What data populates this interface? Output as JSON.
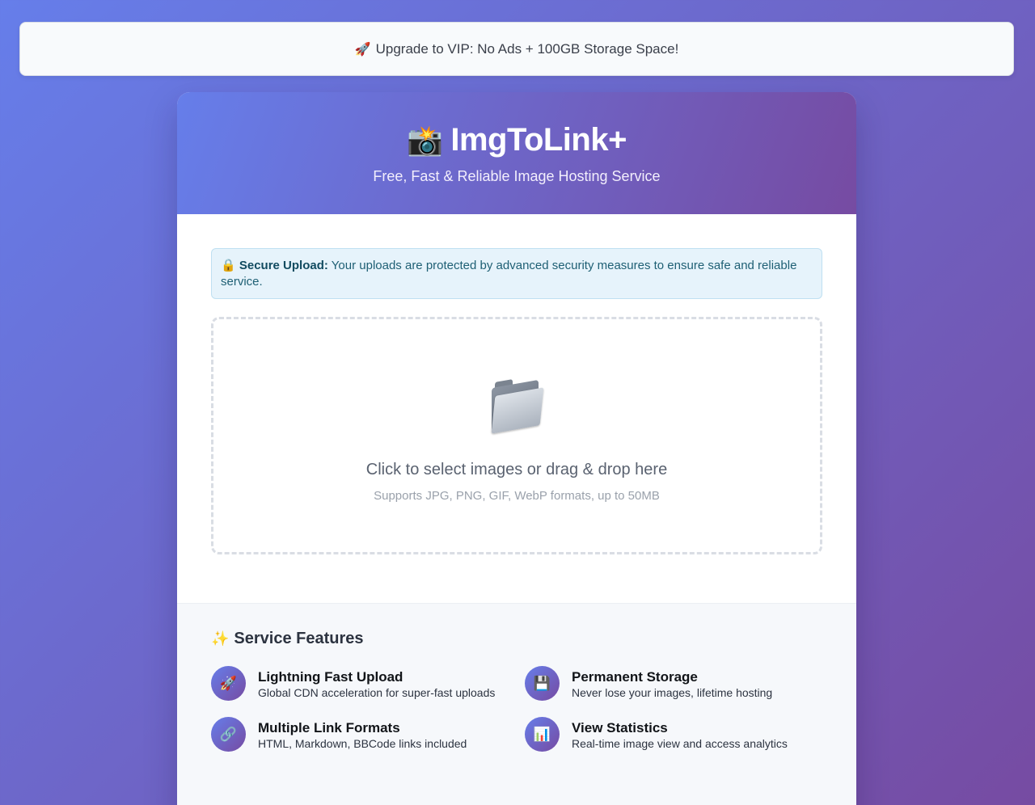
{
  "vip_banner": {
    "icon": "rocket-icon",
    "glyph": "🚀",
    "text": "Upgrade to VIP: No Ads + 100GB Storage Space!"
  },
  "header": {
    "logo_icon": "camera-flash-icon",
    "logo_glyph": "📸",
    "title": "ImgToLink+",
    "subtitle": "Free, Fast & Reliable Image Hosting Service"
  },
  "security_notice": {
    "icon": "lock-icon",
    "glyph": "🔒",
    "label": "Secure Upload:",
    "text": " Your uploads are protected by advanced security measures to ensure safe and reliable service."
  },
  "dropzone": {
    "icon": "folder-icon",
    "title": "Click to select images or drag & drop here",
    "hint": "Supports JPG, PNG, GIF, WebP formats, up to 50MB"
  },
  "features": {
    "icon": "sparkles-icon",
    "glyph": "✨",
    "title": "Service Features",
    "items": [
      {
        "icon": "rocket-icon",
        "glyph": "🚀",
        "name": "Lightning Fast Upload",
        "desc": "Global CDN acceleration for super-fast uploads"
      },
      {
        "icon": "floppy-disk-icon",
        "glyph": "💾",
        "name": "Permanent Storage",
        "desc": "Never lose your images, lifetime hosting"
      },
      {
        "icon": "link-icon",
        "glyph": "🔗",
        "name": "Multiple Link Formats",
        "desc": "HTML, Markdown, BBCode links included"
      },
      {
        "icon": "bar-chart-icon",
        "glyph": "📊",
        "name": "View Statistics",
        "desc": "Real-time image view and access analytics"
      }
    ]
  },
  "colors": {
    "gradient_start": "#667eea",
    "gradient_end": "#764ba2",
    "notice_bg": "#e6f3fb",
    "notice_text": "#1e5f74"
  }
}
